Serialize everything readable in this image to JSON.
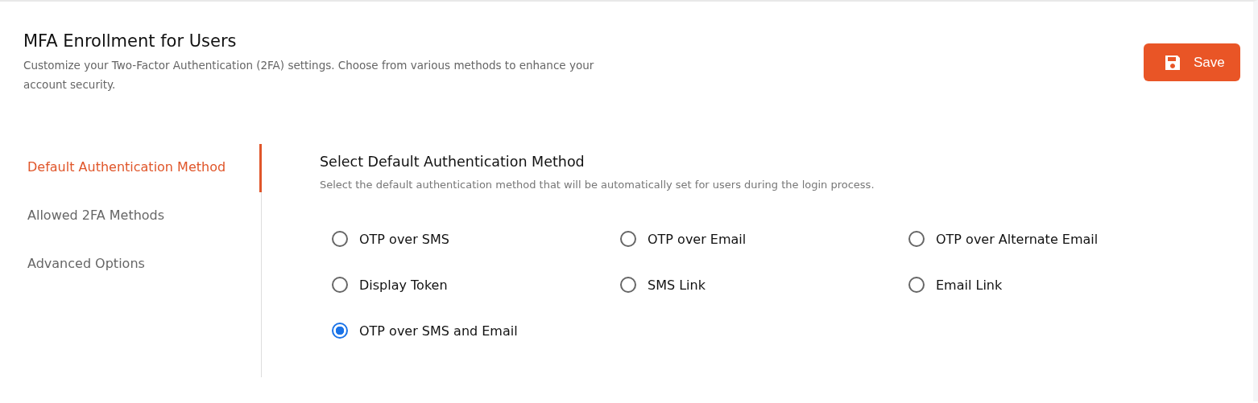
{
  "header": {
    "title": "MFA Enrollment for Users",
    "description": "Customize your Two-Factor Authentication (2FA) settings. Choose from various methods to enhance your account security.",
    "save_button": "Save"
  },
  "sidebar": {
    "items": [
      {
        "label": "Default Authentication Method",
        "selected": true
      },
      {
        "label": "Allowed 2FA Methods",
        "selected": false
      },
      {
        "label": "Advanced Options",
        "selected": false
      }
    ]
  },
  "section": {
    "title": "Select Default Authentication Method",
    "description": "Select the default authentication method that will be automatically set for users during the login process.",
    "options": [
      {
        "label": "OTP over SMS",
        "selected": false
      },
      {
        "label": "OTP over Email",
        "selected": false
      },
      {
        "label": "OTP over Alternate Email",
        "selected": false
      },
      {
        "label": "Display Token",
        "selected": false
      },
      {
        "label": "SMS Link",
        "selected": false
      },
      {
        "label": "Email Link",
        "selected": false
      },
      {
        "label": "OTP over SMS and Email",
        "selected": true
      }
    ]
  }
}
